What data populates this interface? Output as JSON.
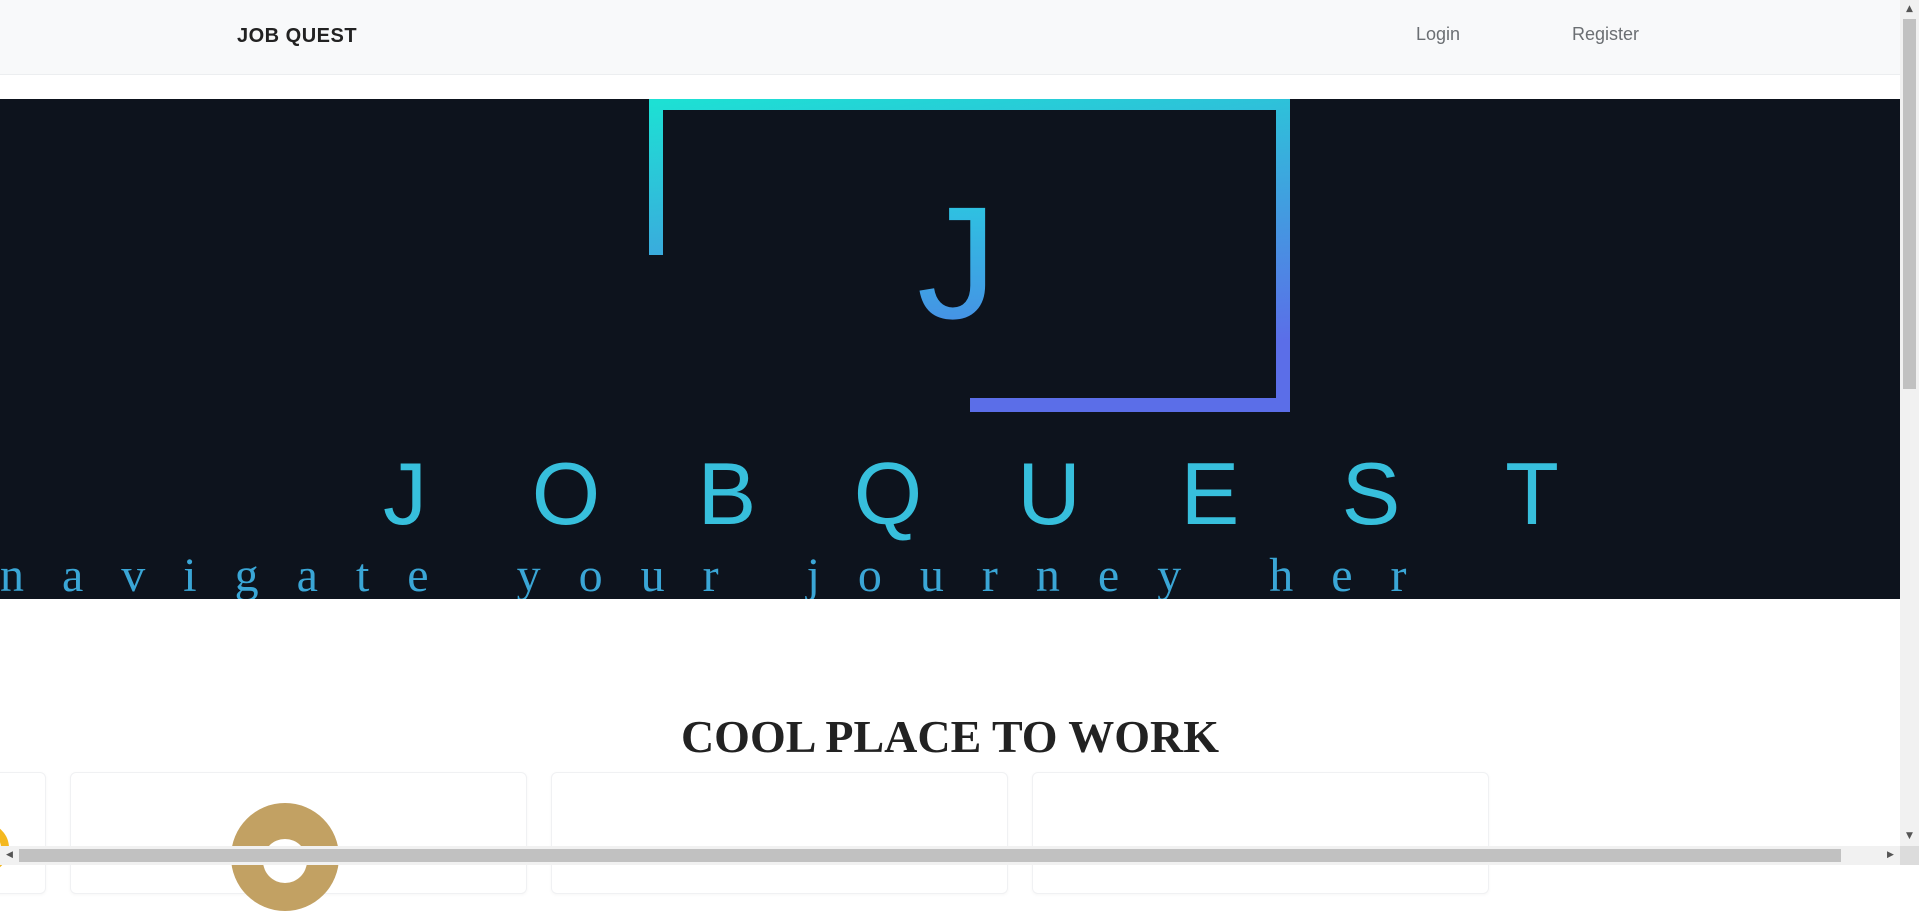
{
  "navbar": {
    "brand": "JOB QUEST",
    "links": {
      "login": "Login",
      "register": "Register"
    }
  },
  "hero": {
    "logo_letter": "J",
    "brand_letters": [
      "J",
      "O",
      "B",
      "Q",
      "U",
      "E",
      "S",
      "T"
    ],
    "tagline": "navigate your journey her",
    "colors": {
      "background": "#0d131d",
      "gradient_start": "#1de0d4",
      "gradient_end": "#5b6ee8",
      "text": "#37bfdc",
      "tagline": "#3aa6d6"
    }
  },
  "section": {
    "title": "COOL PLACE TO WORK"
  },
  "cards": [
    {
      "logo_color": "#f4b81f"
    },
    {
      "logo_color": "#c2a163"
    },
    {
      "logo_color": ""
    },
    {
      "logo_color": ""
    }
  ],
  "scrollbars": {
    "up_arrow_icon": "▲",
    "down_arrow_icon": "▼",
    "left_arrow_icon": "◀",
    "right_arrow_icon": "▶"
  }
}
